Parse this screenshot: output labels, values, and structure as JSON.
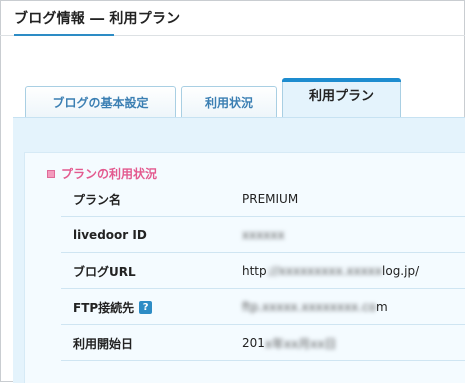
{
  "page": {
    "title": "ブログ情報 ― 利用プラン"
  },
  "tabs": [
    {
      "label": "ブログの基本設定",
      "active": false
    },
    {
      "label": "利用状況",
      "active": false
    },
    {
      "label": "利用プラン",
      "active": true
    }
  ],
  "section": {
    "title": "プランの利用状況",
    "rows": [
      {
        "label": "プラン名",
        "value": "PREMIUM",
        "obscured": false
      },
      {
        "label": "livedoor ID",
        "value": "",
        "obscured": true
      },
      {
        "label": "ブログURL",
        "value_prefix": "http",
        "value_suffix": "log.jp/",
        "obscured": true
      },
      {
        "label": "FTP接続先",
        "help_icon": "?",
        "value_suffix": "m",
        "obscured": true
      },
      {
        "label": "利用開始日",
        "value_prefix": "201",
        "obscured": true
      }
    ]
  },
  "colors": {
    "accent": "#1d8ccf",
    "tab_text": "#3b7fb3",
    "section_pink": "#e35a8f",
    "panel_bg": "#e4f3fc"
  }
}
